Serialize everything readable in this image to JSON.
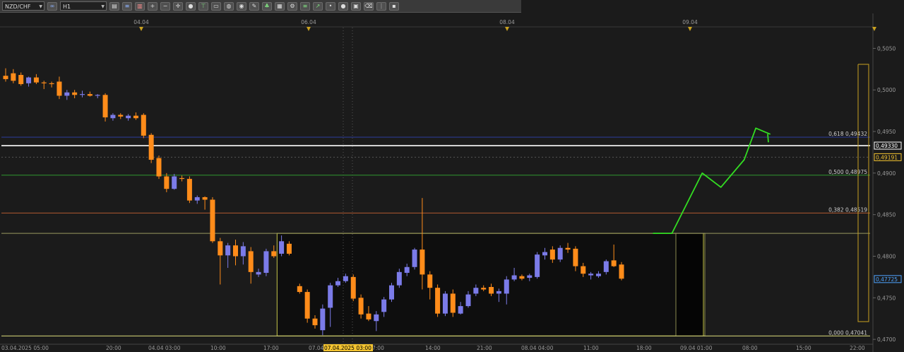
{
  "toolbar": {
    "symbol": "NZD/CHF",
    "timeframe": "H1",
    "icons": [
      "link-icon",
      "chart-type-icon",
      "zoom-in-icon",
      "zoom-out-icon",
      "crosshair-icon",
      "line-tool-icon",
      "fib-tool-icon",
      "text-tool-icon",
      "color-icon",
      "pencil-icon",
      "indicator-icon",
      "template-icon",
      "settings-icon",
      "trash-icon"
    ]
  },
  "chart_data": {
    "type": "candlestick",
    "symbol": "NZD/CHF",
    "timeframe": "H1",
    "price_axis": {
      "range": [
        0.4695,
        0.5075
      ],
      "ticks": [
        "0,5050",
        "0,5000",
        "0,4950",
        "0,4900",
        "0,4850",
        "0,4800",
        "0,4750",
        "0,4700"
      ],
      "tick_values": [
        0.505,
        0.5,
        0.495,
        0.49,
        0.485,
        0.48,
        0.475,
        0.47
      ],
      "markers": [
        {
          "label": "0,49330",
          "value": 0.4933,
          "color": "#ffffff"
        },
        {
          "label": "0,49191",
          "value": 0.49191,
          "color": "#f4c430"
        },
        {
          "label": "0,47725",
          "value": 0.47725,
          "color": "#4ea3ff"
        }
      ]
    },
    "top_date_labels": [
      "04.04",
      "06.04",
      "08.04",
      "09.04"
    ],
    "time_axis_labels": [
      "03.04.2025 05:00",
      "20:00",
      "04.04 03:00",
      "10:00",
      "17:00",
      "07.04",
      "07.04.2025 03:00",
      "7:00",
      "14:00",
      "21:00",
      "08.04 04:00",
      "11:00",
      "18:00",
      "09.04 01:00",
      "08:00",
      "15:00",
      "22:00"
    ],
    "fib_levels": [
      {
        "label": "0,618 0,49432",
        "value": 0.49432,
        "color": "#2b3a8f"
      },
      {
        "label": "0,500 0,48975",
        "value": 0.48975,
        "color": "#2e8b2e"
      },
      {
        "label": "0,382 0,48519",
        "value": 0.48519,
        "color": "#a0522d"
      },
      {
        "label": "0,000 0,47041",
        "value": 0.47041,
        "color": "#c8c870"
      }
    ],
    "horizontal_lines": [
      {
        "value": 0.4933,
        "color": "#ffffff"
      },
      {
        "value": 0.48275,
        "color": "#9a9a60"
      }
    ],
    "candles": [
      {
        "o": 0.5017,
        "h": 0.5026,
        "l": 0.501,
        "c": 0.5013
      },
      {
        "o": 0.502,
        "h": 0.5025,
        "l": 0.5008,
        "c": 0.5011
      },
      {
        "o": 0.5018,
        "h": 0.5021,
        "l": 0.5005,
        "c": 0.5007
      },
      {
        "o": 0.5008,
        "h": 0.5016,
        "l": 0.5004,
        "c": 0.5015
      },
      {
        "o": 0.5015,
        "h": 0.5019,
        "l": 0.5007,
        "c": 0.5009
      },
      {
        "o": 0.5009,
        "h": 0.5011,
        "l": 0.5001,
        "c": 0.5008
      },
      {
        "o": 0.5008,
        "h": 0.501,
        "l": 0.5003,
        "c": 0.5007
      },
      {
        "o": 0.501,
        "h": 0.5016,
        "l": 0.4989,
        "c": 0.4993
      },
      {
        "o": 0.4993,
        "h": 0.5,
        "l": 0.4988,
        "c": 0.4997
      },
      {
        "o": 0.4997,
        "h": 0.5,
        "l": 0.499,
        "c": 0.4994
      },
      {
        "o": 0.4994,
        "h": 0.4999,
        "l": 0.4991,
        "c": 0.4995
      },
      {
        "o": 0.4995,
        "h": 0.4998,
        "l": 0.4992,
        "c": 0.4993
      },
      {
        "o": 0.4993,
        "h": 0.4995,
        "l": 0.499,
        "c": 0.4994
      },
      {
        "o": 0.4994,
        "h": 0.4996,
        "l": 0.4962,
        "c": 0.4967
      },
      {
        "o": 0.4966,
        "h": 0.4972,
        "l": 0.4963,
        "c": 0.497
      },
      {
        "o": 0.497,
        "h": 0.4972,
        "l": 0.4965,
        "c": 0.4968
      },
      {
        "o": 0.4966,
        "h": 0.4971,
        "l": 0.4963,
        "c": 0.4969
      },
      {
        "o": 0.4969,
        "h": 0.4973,
        "l": 0.4964,
        "c": 0.4966
      },
      {
        "o": 0.497,
        "h": 0.4972,
        "l": 0.4942,
        "c": 0.4945
      },
      {
        "o": 0.4946,
        "h": 0.4948,
        "l": 0.4912,
        "c": 0.4916
      },
      {
        "o": 0.4918,
        "h": 0.4921,
        "l": 0.4893,
        "c": 0.4896
      },
      {
        "o": 0.4896,
        "h": 0.49,
        "l": 0.4877,
        "c": 0.4881
      },
      {
        "o": 0.4881,
        "h": 0.4899,
        "l": 0.488,
        "c": 0.4896
      },
      {
        "o": 0.4894,
        "h": 0.4897,
        "l": 0.489,
        "c": 0.4893
      },
      {
        "o": 0.4893,
        "h": 0.4896,
        "l": 0.4864,
        "c": 0.4867
      },
      {
        "o": 0.4867,
        "h": 0.4873,
        "l": 0.4863,
        "c": 0.4871
      },
      {
        "o": 0.4871,
        "h": 0.4872,
        "l": 0.4856,
        "c": 0.4868
      },
      {
        "o": 0.4868,
        "h": 0.4871,
        "l": 0.4816,
        "c": 0.4818
      },
      {
        "o": 0.4818,
        "h": 0.4822,
        "l": 0.4766,
        "c": 0.4801
      },
      {
        "o": 0.4801,
        "h": 0.4816,
        "l": 0.4786,
        "c": 0.4813
      },
      {
        "o": 0.4813,
        "h": 0.482,
        "l": 0.4789,
        "c": 0.48
      },
      {
        "o": 0.48,
        "h": 0.4817,
        "l": 0.479,
        "c": 0.4812
      },
      {
        "o": 0.4806,
        "h": 0.4811,
        "l": 0.4767,
        "c": 0.4781
      },
      {
        "o": 0.4778,
        "h": 0.4785,
        "l": 0.4775,
        "c": 0.4781
      },
      {
        "o": 0.478,
        "h": 0.4809,
        "l": 0.4776,
        "c": 0.4806
      },
      {
        "o": 0.4806,
        "h": 0.4813,
        "l": 0.4798,
        "c": 0.48
      },
      {
        "o": 0.4803,
        "h": 0.4825,
        "l": 0.48,
        "c": 0.4818
      },
      {
        "o": 0.4815,
        "h": 0.4818,
        "l": 0.4801,
        "c": 0.4803
      },
      {
        "o": 0.4764,
        "h": 0.4767,
        "l": 0.4755,
        "c": 0.4757
      },
      {
        "o": 0.4757,
        "h": 0.476,
        "l": 0.472,
        "c": 0.4725
      },
      {
        "o": 0.4725,
        "h": 0.4729,
        "l": 0.4713,
        "c": 0.4717
      },
      {
        "o": 0.4711,
        "h": 0.4742,
        "l": 0.4705,
        "c": 0.4737
      },
      {
        "o": 0.4738,
        "h": 0.4768,
        "l": 0.4715,
        "c": 0.4765
      },
      {
        "o": 0.4765,
        "h": 0.4774,
        "l": 0.4763,
        "c": 0.477
      },
      {
        "o": 0.477,
        "h": 0.4779,
        "l": 0.4768,
        "c": 0.4776
      },
      {
        "o": 0.4775,
        "h": 0.4778,
        "l": 0.4746,
        "c": 0.4749
      },
      {
        "o": 0.475,
        "h": 0.4754,
        "l": 0.4725,
        "c": 0.473
      },
      {
        "o": 0.4731,
        "h": 0.474,
        "l": 0.4722,
        "c": 0.4724
      },
      {
        "o": 0.4722,
        "h": 0.4734,
        "l": 0.471,
        "c": 0.473
      },
      {
        "o": 0.4733,
        "h": 0.4751,
        "l": 0.4727,
        "c": 0.4748
      },
      {
        "o": 0.4748,
        "h": 0.4768,
        "l": 0.4745,
        "c": 0.4765
      },
      {
        "o": 0.4765,
        "h": 0.4785,
        "l": 0.4762,
        "c": 0.4781
      },
      {
        "o": 0.478,
        "h": 0.4791,
        "l": 0.4776,
        "c": 0.4787
      },
      {
        "o": 0.4787,
        "h": 0.481,
        "l": 0.4784,
        "c": 0.4808
      },
      {
        "o": 0.4808,
        "h": 0.487,
        "l": 0.476,
        "c": 0.4778
      },
      {
        "o": 0.4778,
        "h": 0.4782,
        "l": 0.4748,
        "c": 0.4762
      },
      {
        "o": 0.4762,
        "h": 0.4766,
        "l": 0.4727,
        "c": 0.4731
      },
      {
        "o": 0.4731,
        "h": 0.4758,
        "l": 0.4728,
        "c": 0.4755
      },
      {
        "o": 0.4755,
        "h": 0.476,
        "l": 0.4727,
        "c": 0.4732
      },
      {
        "o": 0.4731,
        "h": 0.4745,
        "l": 0.473,
        "c": 0.474
      },
      {
        "o": 0.474,
        "h": 0.4758,
        "l": 0.4738,
        "c": 0.4754
      },
      {
        "o": 0.4755,
        "h": 0.4766,
        "l": 0.4752,
        "c": 0.4762
      },
      {
        "o": 0.4762,
        "h": 0.4765,
        "l": 0.4758,
        "c": 0.476
      },
      {
        "o": 0.4763,
        "h": 0.4767,
        "l": 0.4752,
        "c": 0.4755
      },
      {
        "o": 0.4755,
        "h": 0.4761,
        "l": 0.4745,
        "c": 0.4758
      },
      {
        "o": 0.4755,
        "h": 0.4776,
        "l": 0.4742,
        "c": 0.4772
      },
      {
        "o": 0.4772,
        "h": 0.4786,
        "l": 0.477,
        "c": 0.4777
      },
      {
        "o": 0.4776,
        "h": 0.4778,
        "l": 0.4771,
        "c": 0.4773
      },
      {
        "o": 0.4774,
        "h": 0.4779,
        "l": 0.477,
        "c": 0.4777
      },
      {
        "o": 0.4775,
        "h": 0.4805,
        "l": 0.4773,
        "c": 0.4802
      },
      {
        "o": 0.4801,
        "h": 0.481,
        "l": 0.4796,
        "c": 0.4805
      },
      {
        "o": 0.4808,
        "h": 0.4812,
        "l": 0.4792,
        "c": 0.4796
      },
      {
        "o": 0.4796,
        "h": 0.4813,
        "l": 0.4793,
        "c": 0.481
      },
      {
        "o": 0.481,
        "h": 0.4816,
        "l": 0.4804,
        "c": 0.4808
      },
      {
        "o": 0.4809,
        "h": 0.4812,
        "l": 0.4782,
        "c": 0.4788
      },
      {
        "o": 0.4788,
        "h": 0.4792,
        "l": 0.4775,
        "c": 0.4779
      },
      {
        "o": 0.4777,
        "h": 0.4781,
        "l": 0.4772,
        "c": 0.4779
      },
      {
        "o": 0.4776,
        "h": 0.4782,
        "l": 0.4774,
        "c": 0.4779
      },
      {
        "o": 0.4781,
        "h": 0.4796,
        "l": 0.4778,
        "c": 0.4794
      },
      {
        "o": 0.4795,
        "h": 0.4814,
        "l": 0.4787,
        "c": 0.4788
      },
      {
        "o": 0.479,
        "h": 0.4793,
        "l": 0.4771,
        "c": 0.4773
      }
    ],
    "bull_color": "#7b7be8",
    "bear_color": "#ff8c1a",
    "consolidation_box": {
      "top": 0.48275,
      "bottom": 0.47041,
      "color": "#c8c84a"
    },
    "forecast_box": {
      "top": 0.48275,
      "bottom": 0.47041,
      "color": "#8a8a50"
    },
    "projection_path": [
      [
        0.0,
        0.48275
      ],
      [
        0.16,
        0.48275
      ],
      [
        0.42,
        0.49
      ],
      [
        0.58,
        0.4883
      ],
      [
        0.78,
        0.4916
      ],
      [
        0.88,
        0.4954
      ],
      [
        1.0,
        0.4947
      ]
    ],
    "projection_color": "#33dd22",
    "background": "#1b1b1b",
    "grid": false
  }
}
